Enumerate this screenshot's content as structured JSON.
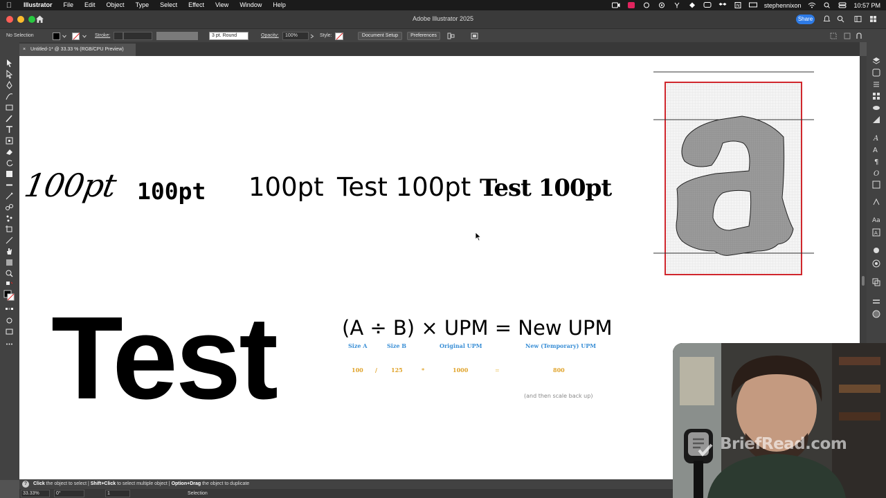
{
  "menubar": {
    "app": "Illustrator",
    "items": [
      "File",
      "Edit",
      "Object",
      "Type",
      "Select",
      "Effect",
      "View",
      "Window",
      "Help"
    ],
    "user": "stephennixon",
    "time": "10:57 PM"
  },
  "titlebar": {
    "title": "Adobe Illustrator 2025",
    "share_label": "Share"
  },
  "controlbar": {
    "selection_label": "No Selection",
    "stroke_label": "Stroke:",
    "brush_value": "3 pt. Round",
    "opacity_label": "Opacity:",
    "opacity_value": "100%",
    "style_label": "Style:",
    "document_setup": "Document Setup",
    "preferences": "Preferences"
  },
  "document_tab": {
    "close": "×",
    "label": "Untitled-1* @ 33.33 % (RGB/CPU Preview)"
  },
  "canvas": {
    "samples": {
      "script": "100pt",
      "mono": "100pt",
      "sans": "100pt",
      "test_sans": "Test 100pt",
      "test_blackletter": "Test 100pt"
    },
    "big_test": "Test",
    "formula": "(A ÷ B) × UPM = New UPM",
    "labels": {
      "size_a": "Size A",
      "size_b": "Size B",
      "original_upm": "Original UPM",
      "new_upm": "New (Temporary) UPM"
    },
    "values": {
      "a": "100",
      "div": "/",
      "b": "125",
      "times": "*",
      "upm": "1000",
      "eq": "=",
      "new": "800"
    },
    "note": "(and then scale back up)"
  },
  "statusbar": {
    "help": "?",
    "click": "Click",
    "click_text": " the object to select  |  ",
    "shift_click": "Shift+Click",
    "shift_text": " to select multiple object  |  ",
    "option_drag": "Option+Drag",
    "option_text": " the object to duplicate"
  },
  "bottombar": {
    "zoom": "33.33%",
    "rotation": "0°",
    "artboard": "1",
    "mode": "Selection"
  },
  "watermark": "BriefRead.com",
  "colors": {
    "accent_blue": "#3a8fd6",
    "gold": "#e0a32a",
    "artboard_red": "#d0262c",
    "share_blue": "#2d7ae5"
  }
}
